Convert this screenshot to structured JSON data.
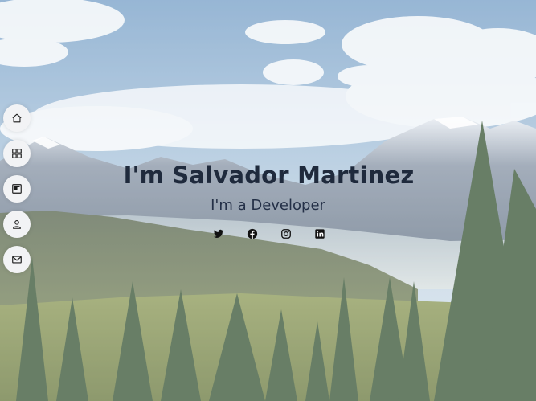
{
  "hero": {
    "name": "I'm Salvador Martinez",
    "role_prefix": "I'm a ",
    "role": "Developer"
  },
  "nav": [
    {
      "icon": "home-icon"
    },
    {
      "icon": "grid-icon"
    },
    {
      "icon": "resume-icon"
    },
    {
      "icon": "person-icon"
    },
    {
      "icon": "envelope-icon"
    }
  ],
  "socials": [
    {
      "icon": "twitter-icon"
    },
    {
      "icon": "facebook-icon"
    },
    {
      "icon": "instagram-icon"
    },
    {
      "icon": "linkedin-icon"
    }
  ],
  "colors": {
    "title": "#1f2a3c",
    "nav_bg": "#f2f3f5",
    "icon": "#1a1a1a"
  }
}
